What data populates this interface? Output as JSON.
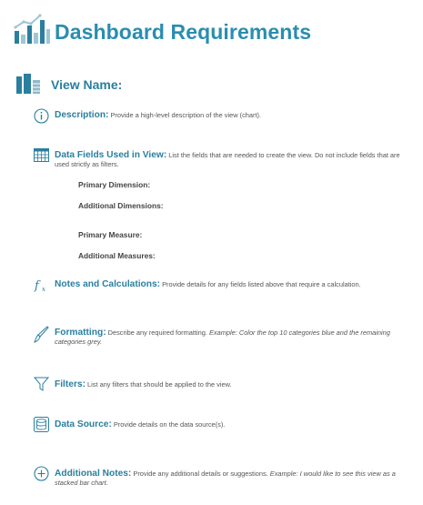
{
  "title": "Dashboard Requirements",
  "view_name_label": "View Name:",
  "sections": {
    "description": {
      "heading": "Description:",
      "text": "Provide a high-level description of the view (chart)."
    },
    "data_fields": {
      "heading": "Data Fields Used in View:",
      "text": "List the fields that are needed to create the view. Do not include fields that are used strictly as filters.",
      "subfields": [
        "Primary Dimension:",
        "Additional Dimensions:",
        "Primary Measure:",
        "Additional Measures:"
      ]
    },
    "notes": {
      "heading": "Notes and Calculations:",
      "text": "Provide details for any fields listed above that require a calculation."
    },
    "formatting": {
      "heading": "Formatting:",
      "text": "Describe any required formatting.",
      "example": "Example: Color the top 10 categories blue and the remaining categories grey."
    },
    "filters": {
      "heading": "Filters:",
      "text": "List any filters that should be applied to the view."
    },
    "data_source": {
      "heading": "Data Source:",
      "text": "Provide details on the data source(s)."
    },
    "additional_notes": {
      "heading": "Additional Notes:",
      "text": "Provide any additional details or suggestions.",
      "example": "Example: I would like to see this view as a stacked bar chart."
    }
  },
  "colors": {
    "accent": "#2a7f9e",
    "title": "#2a8db0",
    "text": "#555555"
  },
  "icons": [
    "bar-chart-logo-icon",
    "view-bars-icon",
    "info-icon",
    "table-grid-icon",
    "function-icon",
    "brush-icon",
    "filter-icon",
    "database-icon",
    "plus-circle-icon"
  ]
}
